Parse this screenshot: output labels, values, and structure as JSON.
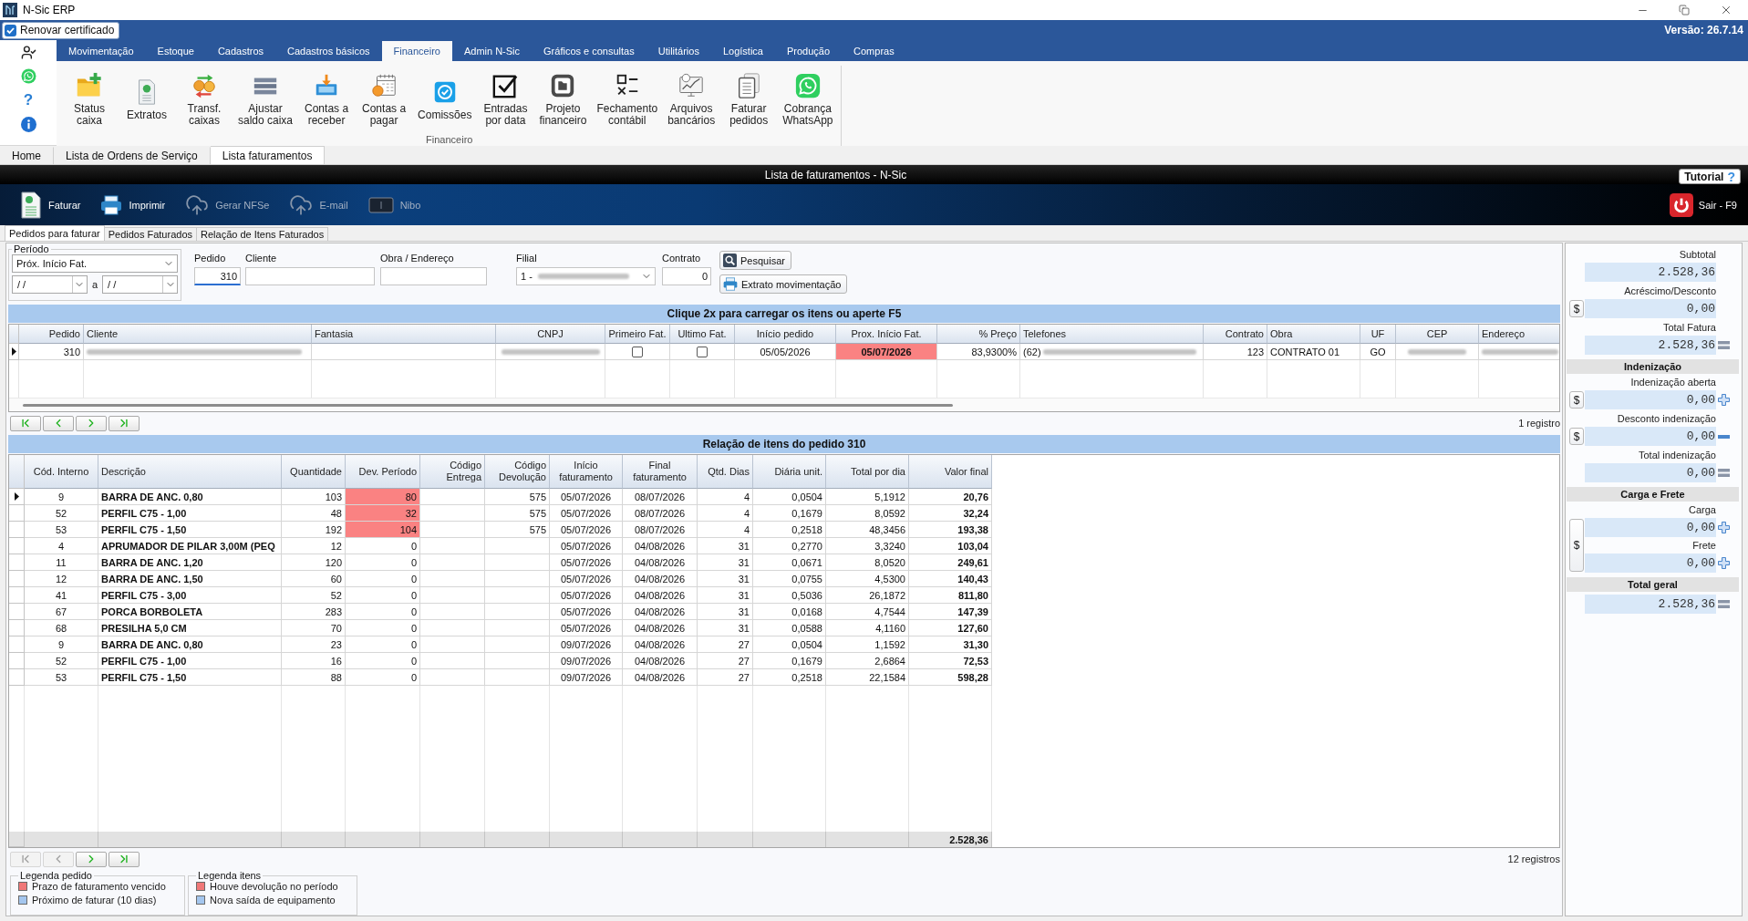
{
  "window": {
    "title": "N-Sic ERP"
  },
  "top_bar": {
    "certificate": {
      "label": "Renovar certificado",
      "checked": true
    },
    "version": "Versão: 26.7.14"
  },
  "left_rail": {
    "help": "?"
  },
  "ribbon": {
    "tabs": [
      {
        "label": "Movimentação",
        "selected": false
      },
      {
        "label": "Estoque",
        "selected": false
      },
      {
        "label": "Cadastros",
        "selected": false
      },
      {
        "label": "Cadastros básicos",
        "selected": false
      },
      {
        "label": "Financeiro",
        "selected": true
      },
      {
        "label": "Admin N-Sic",
        "selected": false
      },
      {
        "label": "Gráficos e consultas",
        "selected": false
      },
      {
        "label": "Utilitários",
        "selected": false
      },
      {
        "label": "Logística",
        "selected": false
      },
      {
        "label": "Produção",
        "selected": false
      },
      {
        "label": "Compras",
        "selected": false
      }
    ],
    "group": {
      "label": "Financeiro",
      "buttons": [
        "Status\ncaixa",
        "Extratos",
        "Transf.\ncaixas",
        "Ajustar\nsaldo caixa",
        "Contas a\nreceber",
        "Contas a\npagar",
        "Comissões",
        "Entradas\npor data",
        "Projeto\nfinanceiro",
        "Fechamento\ncontábil",
        "Arquivos\nbancários",
        "Faturar\npedidos",
        "Cobrança\nWhatsApp"
      ]
    }
  },
  "document_tabs": [
    {
      "label": "Home",
      "selected": false
    },
    {
      "label": "Lista de Ordens de Serviço",
      "selected": false
    },
    {
      "label": "Lista faturamentos",
      "selected": true
    }
  ],
  "header": {
    "title": "Lista de faturamentos - N-Sic",
    "tutorial": {
      "label": "Tutorial",
      "help": "?"
    }
  },
  "toolbar": {
    "buttons": [
      {
        "label": "Faturar",
        "disabled": false
      },
      {
        "label": "Imprimir",
        "disabled": false
      },
      {
        "label": "Gerar NFSe",
        "disabled": true
      },
      {
        "label": "E-mail",
        "disabled": true
      },
      {
        "label": "Nibo",
        "disabled": true
      }
    ],
    "exit": "Sair - F9"
  },
  "sub_tabs": [
    {
      "label": "Pedidos para faturar",
      "selected": true
    },
    {
      "label": "Pedidos Faturados",
      "selected": false
    },
    {
      "label": "Relação de Itens Faturados",
      "selected": false
    }
  ],
  "filters": {
    "period": {
      "legend": "Período",
      "value": "Próx. Início Fat.",
      "date_from": "/ /",
      "separator": "a",
      "date_to": "/ /"
    },
    "fields": [
      {
        "label": "Pedido",
        "kind": "number",
        "value": "310",
        "focused": true,
        "blurred": false
      },
      {
        "label": "Cliente",
        "kind": "text",
        "focused": false,
        "blurred": false
      },
      {
        "label": "Obra / Endereço",
        "kind": "text",
        "focused": false,
        "blurred": false
      },
      {
        "label": "Filial",
        "kind": "select",
        "value": "1 -",
        "focused": false,
        "blurred": true
      },
      {
        "label": "Contrato",
        "kind": "number",
        "value": "0",
        "focused": false,
        "blurred": false
      }
    ],
    "buttons": [
      "Pesquisar",
      "Extrato movimentação"
    ]
  },
  "orders": {
    "banner": "Clique 2x para carregar os itens ou aperte F5",
    "columns": [
      "Pedido",
      "Cliente",
      "Fantasia",
      "CNPJ",
      "Primeiro Fat.",
      "Ultimo Fat.",
      "Início pedido",
      "Prox. Início Fat.",
      "% Preço",
      "Telefones",
      "Contrato",
      "Obra",
      "UF",
      "CEP",
      "Endereço"
    ],
    "rows": [
      {
        "selected": true,
        "overdue": true,
        "pedido": "310",
        "cliente": {
          "kind": "blurred"
        },
        "cnpj": {
          "kind": "blurred"
        },
        "primeiro_fat": {
          "kind": "checkbox",
          "checked": false
        },
        "ultimo_fat": {
          "kind": "checkbox",
          "checked": false
        },
        "inicio_pedido": "05/05/2026",
        "prox_inicio_fat": "05/07/2026",
        "preco": "83,9300%",
        "telefones": {
          "kind": "blurred",
          "text": "(62)"
        },
        "contrato": "123",
        "obra": "CONTRATO 01",
        "uf": "GO",
        "cep": {
          "kind": "blurred"
        },
        "endereco": {
          "kind": "blurred"
        }
      }
    ],
    "nav": [
      {
        "kind": "first",
        "disabled": false
      },
      {
        "kind": "previous",
        "disabled": false
      },
      {
        "kind": "next",
        "disabled": false
      },
      {
        "kind": "last",
        "disabled": false
      }
    ],
    "count": "1 registro"
  },
  "items": {
    "banner": "Relação de itens do pedido 310",
    "columns": [
      "Cód. Interno",
      "Descrição",
      "Quantidade",
      "Dev. Período",
      "Código\nEntrega",
      "Código\nDevolução",
      "Início\nfaturamento",
      "Final\nfaturamento",
      "Qtd. Dias",
      "Diária unit.",
      "Total por dia",
      "Valor final"
    ],
    "rows": [
      {
        "selected": true,
        "returned": true,
        "cod_interno": "9",
        "descricao": "BARRA DE ANC. 0,80",
        "quantidade": "103",
        "dev_periodo": "80",
        "codigo_devolucao": "575",
        "inicio_faturamento": "05/07/2026",
        "final_faturamento": "08/07/2026",
        "qtd_dias": "4",
        "diaria_unit": "0,0504",
        "total_por_dia": "5,1912",
        "valor_final": "20,76"
      },
      {
        "selected": false,
        "returned": true,
        "cod_interno": "52",
        "descricao": "PERFIL C75 - 1,00",
        "quantidade": "48",
        "dev_periodo": "32",
        "codigo_devolucao": "575",
        "inicio_faturamento": "05/07/2026",
        "final_faturamento": "08/07/2026",
        "qtd_dias": "4",
        "diaria_unit": "0,1679",
        "total_por_dia": "8,0592",
        "valor_final": "32,24"
      },
      {
        "selected": false,
        "returned": true,
        "cod_interno": "53",
        "descricao": "PERFIL C75 - 1,50",
        "quantidade": "192",
        "dev_periodo": "104",
        "codigo_devolucao": "575",
        "inicio_faturamento": "05/07/2026",
        "final_faturamento": "08/07/2026",
        "qtd_dias": "4",
        "diaria_unit": "0,2518",
        "total_por_dia": "48,3456",
        "valor_final": "193,38"
      },
      {
        "selected": false,
        "returned": false,
        "cod_interno": "4",
        "descricao": "APRUMADOR DE PILAR 3,00M (PEQ",
        "quantidade": "12",
        "dev_periodo": "0",
        "inicio_faturamento": "05/07/2026",
        "final_faturamento": "04/08/2026",
        "qtd_dias": "31",
        "diaria_unit": "0,2770",
        "total_por_dia": "3,3240",
        "valor_final": "103,04"
      },
      {
        "selected": false,
        "returned": false,
        "cod_interno": "11",
        "descricao": "BARRA DE ANC. 1,20",
        "quantidade": "120",
        "dev_periodo": "0",
        "inicio_faturamento": "05/07/2026",
        "final_faturamento": "04/08/2026",
        "qtd_dias": "31",
        "diaria_unit": "0,0671",
        "total_por_dia": "8,0520",
        "valor_final": "249,61"
      },
      {
        "selected": false,
        "returned": false,
        "cod_interno": "12",
        "descricao": "BARRA DE ANC. 1,50",
        "quantidade": "60",
        "dev_periodo": "0",
        "inicio_faturamento": "05/07/2026",
        "final_faturamento": "04/08/2026",
        "qtd_dias": "31",
        "diaria_unit": "0,0755",
        "total_por_dia": "4,5300",
        "valor_final": "140,43"
      },
      {
        "selected": false,
        "returned": false,
        "cod_interno": "41",
        "descricao": "PERFIL C75 - 3,00",
        "quantidade": "52",
        "dev_periodo": "0",
        "inicio_faturamento": "05/07/2026",
        "final_faturamento": "04/08/2026",
        "qtd_dias": "31",
        "diaria_unit": "0,5036",
        "total_por_dia": "26,1872",
        "valor_final": "811,80"
      },
      {
        "selected": false,
        "returned": false,
        "cod_interno": "67",
        "descricao": "PORCA BORBOLETA",
        "quantidade": "283",
        "dev_periodo": "0",
        "inicio_faturamento": "05/07/2026",
        "final_faturamento": "04/08/2026",
        "qtd_dias": "31",
        "diaria_unit": "0,0168",
        "total_por_dia": "4,7544",
        "valor_final": "147,39"
      },
      {
        "selected": false,
        "returned": false,
        "cod_interno": "68",
        "descricao": "PRESILHA 5,0 CM",
        "quantidade": "70",
        "dev_periodo": "0",
        "inicio_faturamento": "05/07/2026",
        "final_faturamento": "04/08/2026",
        "qtd_dias": "31",
        "diaria_unit": "0,0588",
        "total_por_dia": "4,1160",
        "valor_final": "127,60"
      },
      {
        "selected": false,
        "returned": false,
        "cod_interno": "9",
        "descricao": "BARRA DE ANC. 0,80",
        "quantidade": "23",
        "dev_periodo": "0",
        "inicio_faturamento": "09/07/2026",
        "final_faturamento": "04/08/2026",
        "qtd_dias": "27",
        "diaria_unit": "0,0504",
        "total_por_dia": "1,1592",
        "valor_final": "31,30"
      },
      {
        "selected": false,
        "returned": false,
        "cod_interno": "52",
        "descricao": "PERFIL C75 - 1,00",
        "quantidade": "16",
        "dev_periodo": "0",
        "inicio_faturamento": "09/07/2026",
        "final_faturamento": "04/08/2026",
        "qtd_dias": "27",
        "diaria_unit": "0,1679",
        "total_por_dia": "2,6864",
        "valor_final": "72,53"
      },
      {
        "selected": false,
        "returned": false,
        "cod_interno": "53",
        "descricao": "PERFIL C75 - 1,50",
        "quantidade": "88",
        "dev_periodo": "0",
        "inicio_faturamento": "09/07/2026",
        "final_faturamento": "04/08/2026",
        "qtd_dias": "27",
        "diaria_unit": "0,2518",
        "total_por_dia": "22,1584",
        "valor_final": "598,28"
      }
    ],
    "footer_total": "2.528,36",
    "nav": [
      {
        "kind": "first",
        "disabled": true
      },
      {
        "kind": "previous",
        "disabled": true
      },
      {
        "kind": "next",
        "disabled": false
      },
      {
        "kind": "last",
        "disabled": false
      }
    ],
    "count": "12 registros"
  },
  "legends": [
    {
      "title": "Legenda pedido",
      "items": [
        {
          "label": "Prazo de faturamento vencido",
          "color": "#f07878"
        },
        {
          "label": "Próximo de faturar (10 dias)",
          "color": "#a4c6ee"
        }
      ]
    },
    {
      "title": "Legenda itens",
      "items": [
        {
          "label": "Houve devolução no período",
          "color": "#f07878"
        },
        {
          "label": "Nova saída de equipamento",
          "color": "#a4c6ee"
        }
      ]
    }
  ],
  "summary": [
    {
      "kind": "field",
      "label": "Subtotal",
      "value": "2.528,36"
    },
    {
      "kind": "field",
      "label": "Acréscimo/Desconto",
      "value": "0,00",
      "currency_button": "$"
    },
    {
      "kind": "total_field",
      "label": "Total Fatura",
      "value": "2.528,36"
    },
    {
      "kind": "heading",
      "label": "Indenização"
    },
    {
      "kind": "add_field",
      "label": "Indenização aberta",
      "value": "0,00",
      "currency_button": "$"
    },
    {
      "kind": "subtract_field",
      "label": "Desconto indenização",
      "value": "0,00",
      "currency_button": "$"
    },
    {
      "kind": "total_field",
      "label": "Total indenização",
      "value": "0,00"
    },
    {
      "kind": "heading",
      "label": "Carga e Frete"
    },
    {
      "kind": "group",
      "currency_button": "$",
      "fields": [
        {
          "kind": "add_field",
          "label": "Carga",
          "value": "0,00"
        },
        {
          "kind": "add_field",
          "label": "Frete",
          "value": "0,00"
        }
      ]
    },
    {
      "kind": "heading",
      "label": "Total geral"
    },
    {
      "kind": "total_field",
      "value": "2.528,36"
    }
  ]
}
